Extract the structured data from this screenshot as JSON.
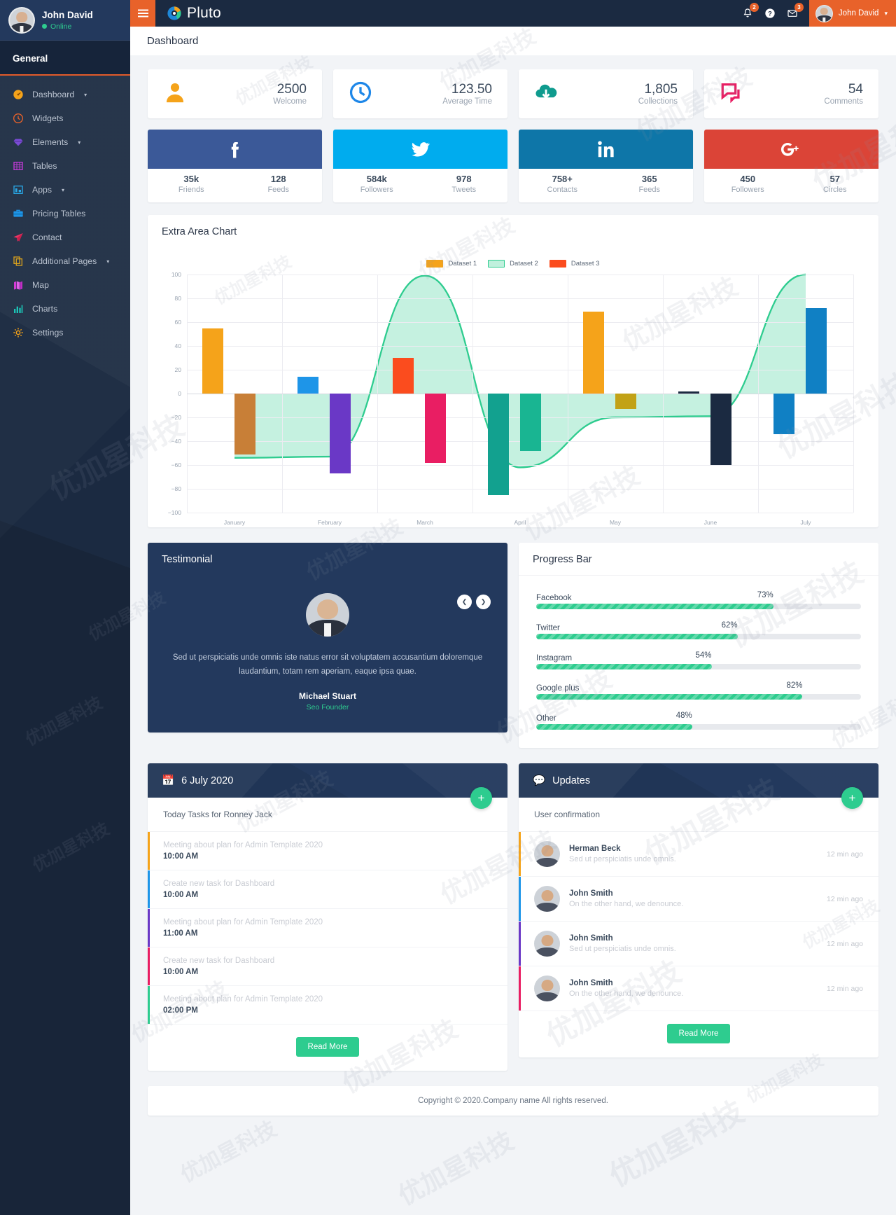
{
  "brand": {
    "name": "Pluto",
    "logo_icon": "pluto-logo-icon"
  },
  "topbar": {
    "menu_toggle_icon": "hamburger-menu-icon",
    "bell_icon": "bell-icon",
    "bell_badge": "2",
    "help_icon": "question-circle-icon",
    "mail_icon": "envelope-icon",
    "mail_badge": "3",
    "user_name": "John David",
    "user_caret_icon": "chevron-down-icon"
  },
  "page": {
    "title": "Dashboard"
  },
  "sidebar": {
    "profile": {
      "name": "John David",
      "status": "Online"
    },
    "section_label": "General",
    "items": [
      {
        "label": "Dashboard",
        "icon": "gauge-icon",
        "has_caret": true
      },
      {
        "label": "Widgets",
        "icon": "clock-icon",
        "has_caret": false
      },
      {
        "label": "Elements",
        "icon": "gem-icon",
        "has_caret": true
      },
      {
        "label": "Tables",
        "icon": "table-icon",
        "has_caret": false
      },
      {
        "label": "Apps",
        "icon": "apps-icon",
        "has_caret": true
      },
      {
        "label": "Pricing Tables",
        "icon": "briefcase-icon",
        "has_caret": false
      },
      {
        "label": "Contact",
        "icon": "paper-plane-icon",
        "has_caret": false
      },
      {
        "label": "Additional Pages",
        "icon": "copy-icon",
        "has_caret": true
      },
      {
        "label": "Map",
        "icon": "map-icon",
        "has_caret": false
      },
      {
        "label": "Charts",
        "icon": "bar-chart-icon",
        "has_caret": false
      },
      {
        "label": "Settings",
        "icon": "gear-icon",
        "has_caret": false
      }
    ]
  },
  "stats": [
    {
      "value": "2500",
      "label": "Welcome",
      "icon": "user-icon",
      "color": "#f5a31a"
    },
    {
      "value": "123.50",
      "label": "Average Time",
      "icon": "clock-icon",
      "color": "#1e87e8"
    },
    {
      "value": "1,805",
      "label": "Collections",
      "icon": "cloud-download-icon",
      "color": "#0f9b8e"
    },
    {
      "value": "54",
      "label": "Comments",
      "icon": "comments-icon",
      "color": "#e91e63"
    }
  ],
  "social": [
    {
      "network": "Facebook",
      "icon": "facebook-icon",
      "color": "#3b5998",
      "metrics": [
        {
          "value": "35k",
          "label": "Friends"
        },
        {
          "value": "128",
          "label": "Feeds"
        }
      ]
    },
    {
      "network": "Twitter",
      "icon": "twitter-icon",
      "color": "#00acee",
      "metrics": [
        {
          "value": "584k",
          "label": "Followers"
        },
        {
          "value": "978",
          "label": "Tweets"
        }
      ]
    },
    {
      "network": "LinkedIn",
      "icon": "linkedin-icon",
      "color": "#0e76a8",
      "metrics": [
        {
          "value": "758+",
          "label": "Contacts"
        },
        {
          "value": "365",
          "label": "Feeds"
        }
      ]
    },
    {
      "network": "Google Plus",
      "icon": "google-plus-icon",
      "color": "#db4437",
      "metrics": [
        {
          "value": "450",
          "label": "Followers"
        },
        {
          "value": "57",
          "label": "Circles"
        }
      ]
    }
  ],
  "chart_card": {
    "title": "Extra Area Chart"
  },
  "chart_data": {
    "type": "bar",
    "title": "Extra Area Chart",
    "xlabel": "",
    "ylabel": "",
    "ylim": [
      -100,
      100
    ],
    "yticks": [
      100,
      80,
      60,
      40,
      20,
      0,
      -20,
      -40,
      -60,
      -80,
      -100
    ],
    "grid": true,
    "legend_position": "top-center",
    "categories": [
      "January",
      "February",
      "March",
      "April",
      "May",
      "June",
      "July"
    ],
    "legend": [
      {
        "name": "Dataset 1",
        "color": "#f5a31a",
        "style": "bar"
      },
      {
        "name": "Dataset 2",
        "color": "#2ecc8f",
        "style": "area"
      },
      {
        "name": "Dataset 3",
        "color": "#fb4c1e",
        "style": "bar"
      }
    ],
    "bars": [
      {
        "month": "January",
        "value": 55,
        "color": "#f5a31a"
      },
      {
        "month": "January",
        "value": -51,
        "color": "#c87f37"
      },
      {
        "month": "February",
        "value": 14,
        "color": "#1e95e8"
      },
      {
        "month": "February",
        "value": -67,
        "color": "#6a38c6"
      },
      {
        "month": "March",
        "value": 30,
        "color": "#fb4c1e"
      },
      {
        "month": "March",
        "value": -58,
        "color": "#e91e63"
      },
      {
        "month": "April",
        "value": -85,
        "color": "#12a18f"
      },
      {
        "month": "April",
        "value": -48,
        "color": "#19b592"
      },
      {
        "month": "May",
        "value": 69,
        "color": "#f5a31a"
      },
      {
        "month": "May",
        "value": -13,
        "color": "#c2a216"
      },
      {
        "month": "June",
        "value": 2,
        "color": "#1b2a41"
      },
      {
        "month": "June",
        "value": -60,
        "color": "#1b2a41"
      },
      {
        "month": "July",
        "value": -34,
        "color": "#1080c4"
      },
      {
        "month": "July",
        "value": 72,
        "color": "#1080c4"
      }
    ],
    "area_series": {
      "name": "Dataset 2",
      "color": "#2ecc8f",
      "fill": "rgba(46,204,143,0.28)",
      "x": [
        "January",
        "February",
        "March",
        "April",
        "May",
        "June",
        "July"
      ],
      "values": [
        -54,
        -53,
        99,
        -62,
        -20,
        -19,
        100
      ]
    }
  },
  "testimonial": {
    "title": "Testimonial",
    "quote": "Sed ut perspiciatis unde omnis iste natus error sit voluptatem accusantium doloremque laudantium, totam rem aperiam, eaque ipsa quae.",
    "author": "Michael Stuart",
    "role": "Seo Founder",
    "prev_icon": "chevron-left-icon",
    "next_icon": "chevron-right-icon"
  },
  "progress_card": {
    "title": "Progress Bar",
    "bar_color": "#2ecc8f",
    "items": [
      {
        "label": "Facebook",
        "percent": "73%",
        "value": 73
      },
      {
        "label": "Twitter",
        "percent": "62%",
        "value": 62
      },
      {
        "label": "Instagram",
        "percent": "54%",
        "value": 54
      },
      {
        "label": "Google plus",
        "percent": "82%",
        "value": 82
      },
      {
        "label": "Other",
        "percent": "48%",
        "value": 48
      }
    ]
  },
  "tasks_card": {
    "title": "6 July 2020",
    "title_icon": "calendar-icon",
    "add_icon": "plus-icon",
    "subtitle": "Today Tasks for Ronney Jack",
    "read_more": "Read More",
    "items": [
      {
        "title": "Meeting about plan for Admin Template 2020",
        "time": "10:00 AM",
        "color": "#f5a31a"
      },
      {
        "title": "Create new task for Dashboard",
        "time": "10:00 AM",
        "color": "#1e95e8"
      },
      {
        "title": "Meeting about plan for Admin Template 2020",
        "time": "11:00 AM",
        "color": "#6a38c6"
      },
      {
        "title": "Create new task for Dashboard",
        "time": "10:00 AM",
        "color": "#e91e63"
      },
      {
        "title": "Meeting about plan for Admin Template 2020",
        "time": "02:00 PM",
        "color": "#2ecc8f"
      }
    ]
  },
  "updates_card": {
    "title": "Updates",
    "title_icon": "comments-icon",
    "add_icon": "plus-icon",
    "subtitle": "User confirmation",
    "read_more": "Read More",
    "items": [
      {
        "name": "Herman Beck",
        "message": "Sed ut perspiciatis unde omnis.",
        "time": "12 min ago",
        "color": "#f5a31a"
      },
      {
        "name": "John Smith",
        "message": "On the other hand, we denounce.",
        "time": "12 min ago",
        "color": "#1e95e8"
      },
      {
        "name": "John Smith",
        "message": "Sed ut perspiciatis unde omnis.",
        "time": "12 min ago",
        "color": "#6a38c6"
      },
      {
        "name": "John Smith",
        "message": "On the other hand, we denounce.",
        "time": "12 min ago",
        "color": "#e91e63"
      }
    ]
  },
  "footer": {
    "text": "Copyright © 2020.Company name All rights reserved."
  },
  "watermark": {
    "text": "优加星科技"
  }
}
